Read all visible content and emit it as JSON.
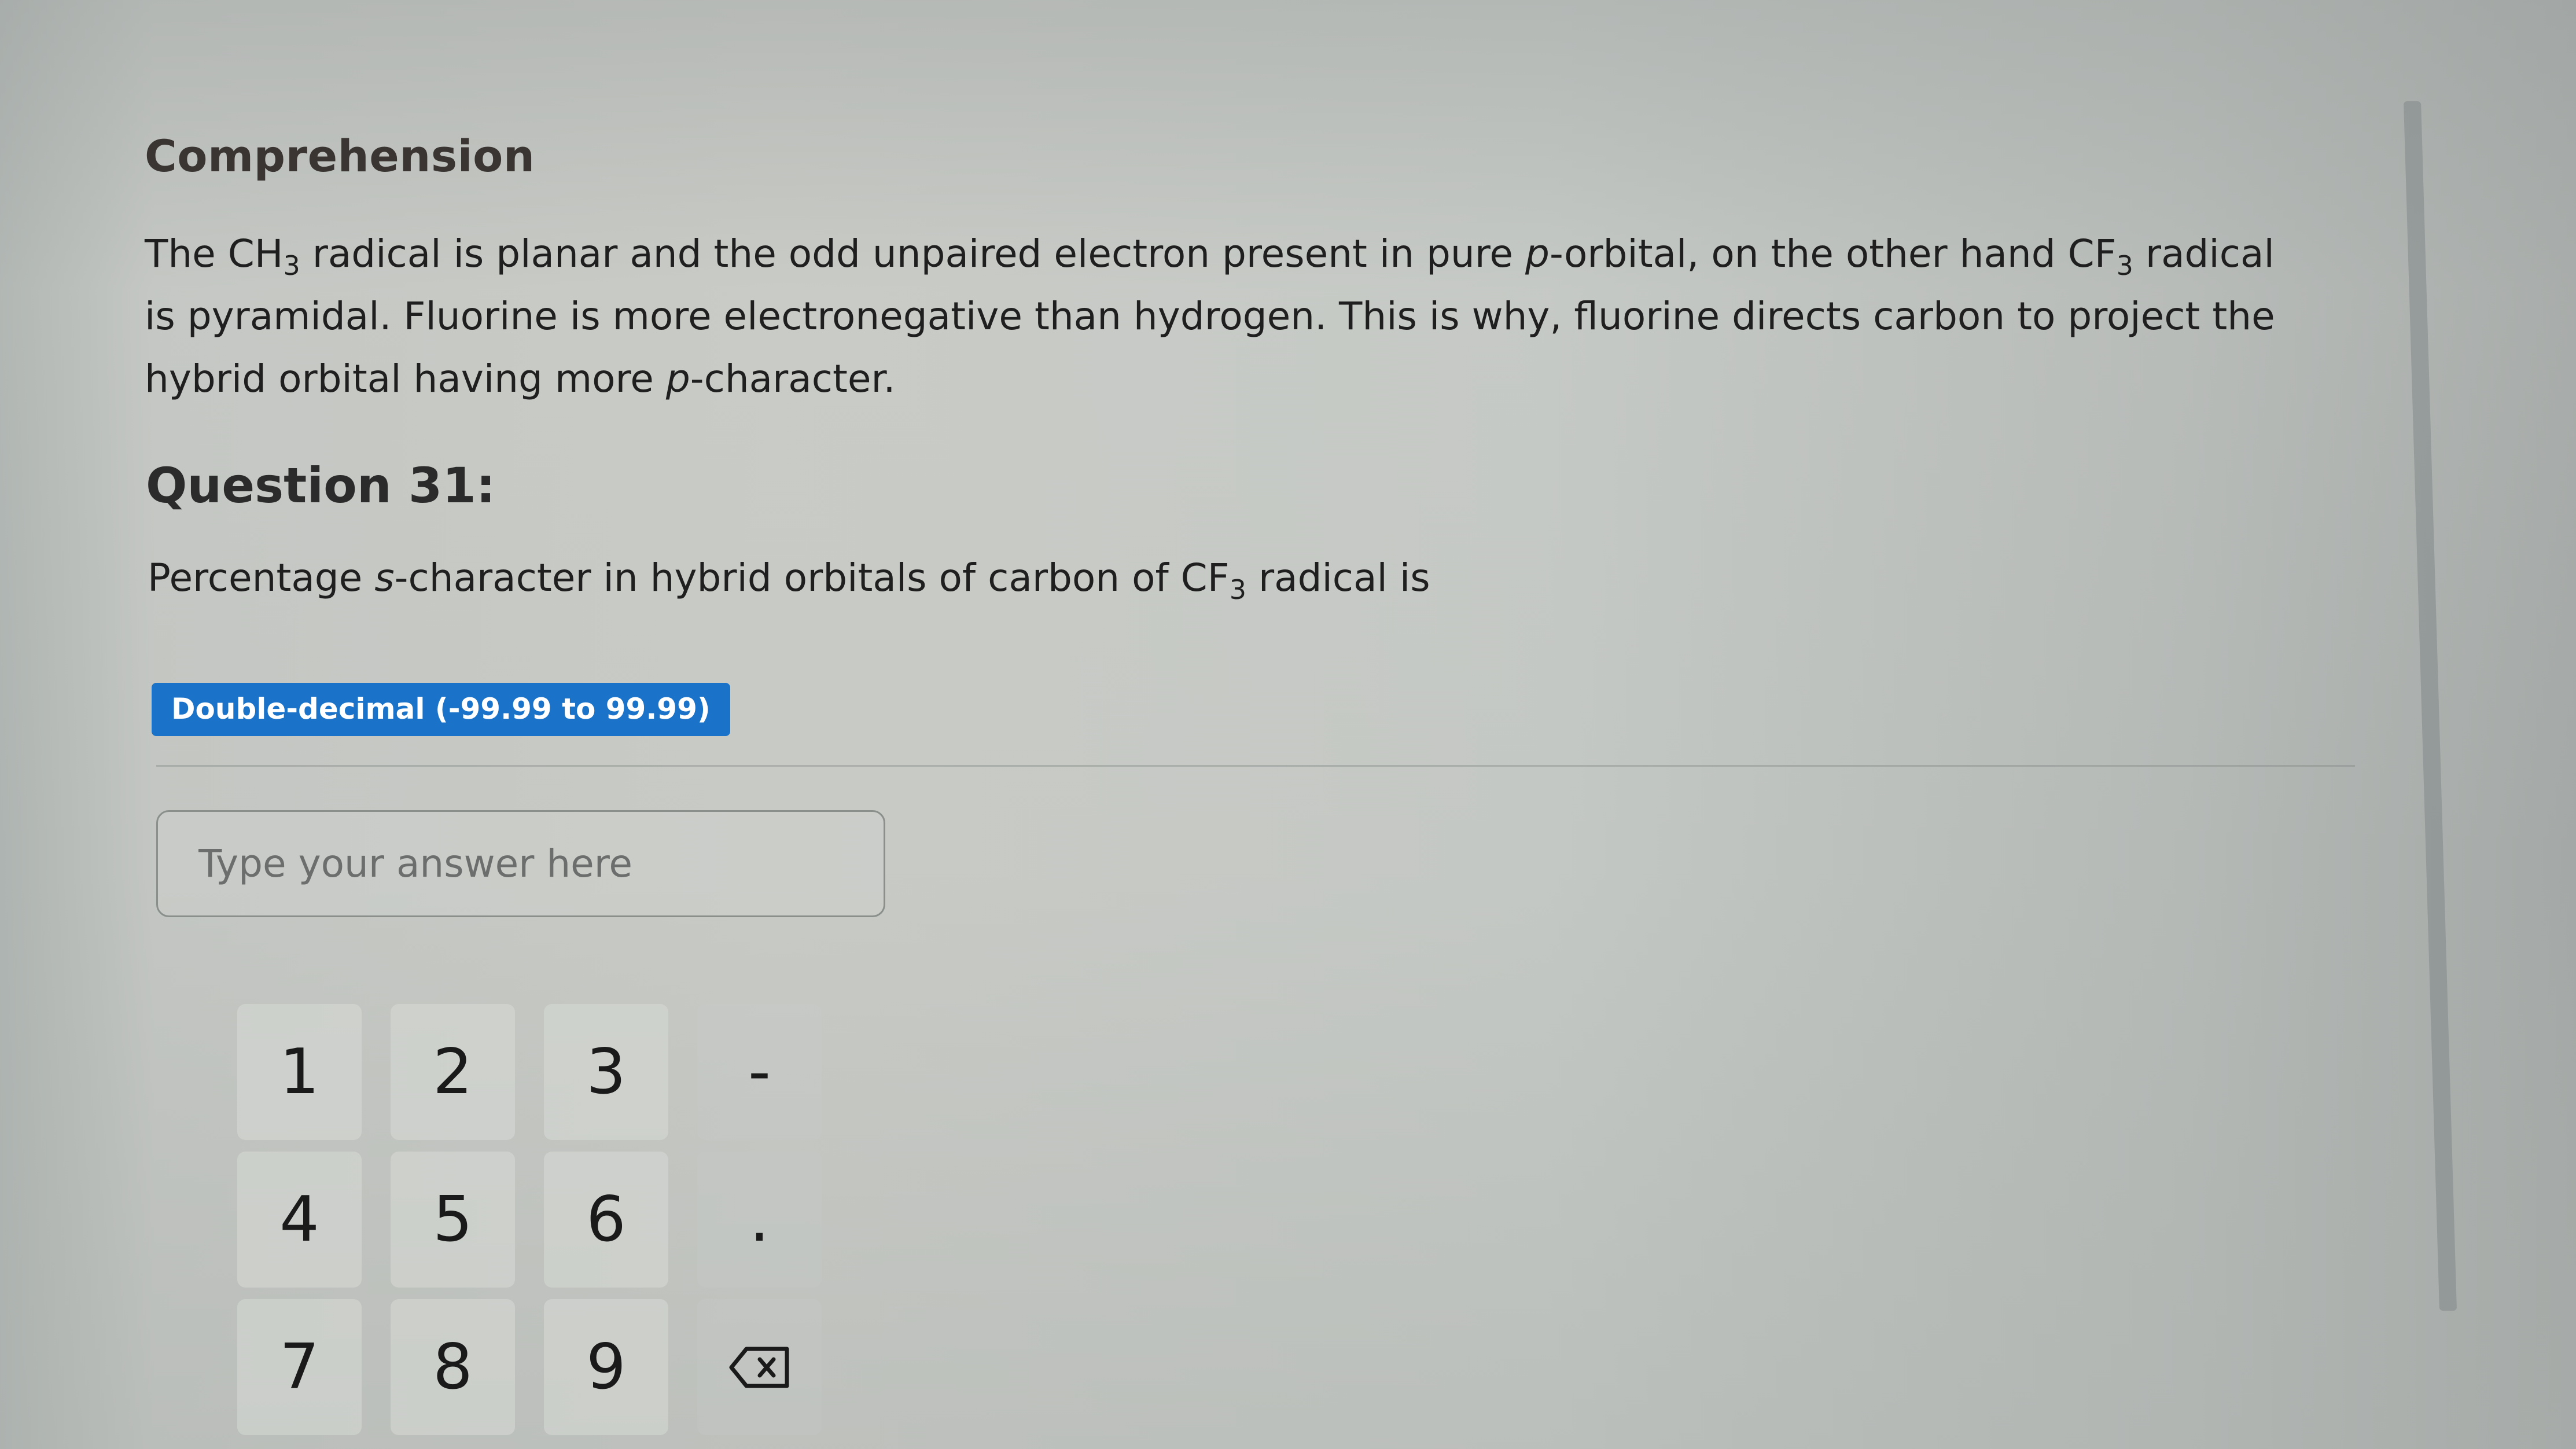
{
  "section": {
    "heading": "Comprehension"
  },
  "passage": {
    "p1": "The CH",
    "p1_sub": "3",
    "p2": " radical is planar and the odd unpaired electron present in pure ",
    "p3_italic": "p",
    "p4": "-orbital, on the other hand CF",
    "p4_sub": "3",
    "p5": " radical is pyramidal. Fluorine is more electronegative than hydrogen. This is why, fluorine directs carbon to project the hybrid orbital having more ",
    "p6_italic": "p",
    "p7": "-character."
  },
  "question": {
    "title": "Question 31:",
    "t1": "Percentage ",
    "t2_italic": "s",
    "t3": "-character in hybrid orbitals of carbon of CF",
    "t3_sub": "3",
    "t4": " radical is",
    "answer_type_badge": "Double-decimal (-99.99 to 99.99)",
    "answer_placeholder": "Type your answer here",
    "answer_value": ""
  },
  "keypad": {
    "keys": [
      "1",
      "2",
      "3",
      "-",
      "4",
      "5",
      "6",
      ".",
      "7",
      "8",
      "9",
      "backspace"
    ],
    "backspace_icon": "backspace-icon"
  },
  "colors": {
    "badge_bg": "#1a73c8",
    "badge_text": "#ffffff"
  }
}
